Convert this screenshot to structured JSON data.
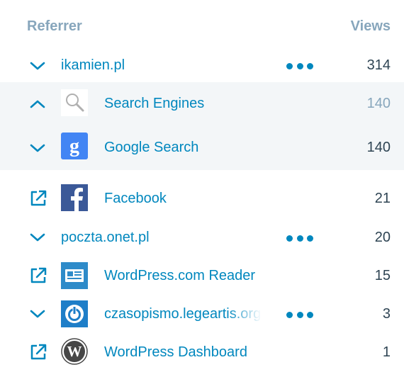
{
  "header": {
    "referrer": "Referrer",
    "views": "Views"
  },
  "rows": [
    {
      "label": "ikamien.pl",
      "views": "314",
      "toggle": "expand",
      "icon": "chevron-down-icon",
      "has_more_menu": true
    },
    {
      "label": "Search Engines",
      "views": "140",
      "toggle": "collapse",
      "icon": "search-icon",
      "muted": true
    },
    {
      "label": "Google Search",
      "views": "140",
      "toggle": "expand",
      "icon": "google-icon"
    },
    {
      "label": "Facebook",
      "views": "21",
      "toggle": "external-link",
      "icon": "facebook-icon"
    },
    {
      "label": "poczta.onet.pl",
      "views": "20",
      "toggle": "expand",
      "icon": "chevron-down-icon",
      "has_more_menu": true
    },
    {
      "label": "WordPress.com Reader",
      "views": "15",
      "toggle": "external-link",
      "icon": "reader-icon"
    },
    {
      "label": "czasopismo.legeartis.org",
      "views": "3",
      "toggle": "expand",
      "icon": "power-icon",
      "has_more_menu": true
    },
    {
      "label": "WordPress Dashboard",
      "views": "1",
      "toggle": "external-link",
      "icon": "wordpress-icon"
    }
  ],
  "colors": {
    "link": "#0087be",
    "header_text": "#87a6bc",
    "count_text": "#2e4453",
    "muted_count": "#87a6bc",
    "group_background": "#f3f6f8",
    "google_blue": "#4285f4",
    "facebook_blue": "#3b5998"
  }
}
